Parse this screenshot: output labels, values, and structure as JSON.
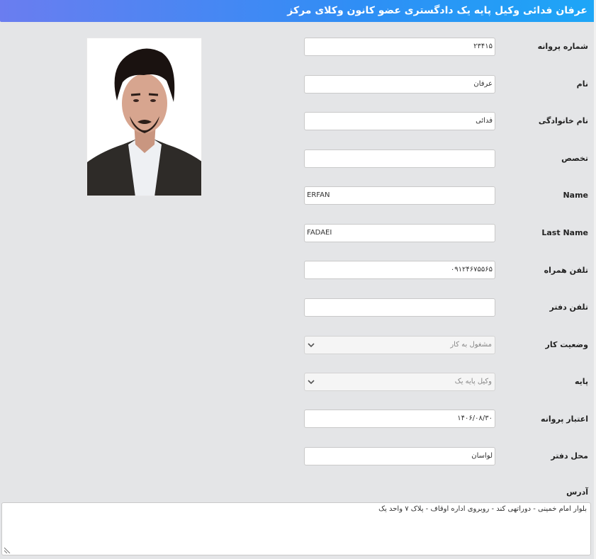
{
  "header": {
    "title": "عرفان فدائی وکیل پایه یک دادگستری عضو کانون وکلای مرکز"
  },
  "form": {
    "license_number": {
      "label": "شماره پروانه",
      "value": "۲۳۴۱۵"
    },
    "first_name": {
      "label": "نام",
      "value": "عرفان"
    },
    "family_name": {
      "label": "نام خانوادگی",
      "value": "فدائی"
    },
    "specialty": {
      "label": "تخصص",
      "value": ""
    },
    "name_en": {
      "label": "Name",
      "value": "ERFAN"
    },
    "last_name_en": {
      "label": "Last Name",
      "value": "FADAEI"
    },
    "mobile": {
      "label": "تلفن همراه",
      "value": "۰۹۱۲۴۶۷۵۵۶۵"
    },
    "office_phone": {
      "label": "تلفن دفتر",
      "value": ""
    },
    "work_status": {
      "label": "وضعیت کار",
      "value": "مشغول به کار"
    },
    "grade": {
      "label": "پایه",
      "value": "وکیل پایه یک"
    },
    "license_validity": {
      "label": "اعتبار پروانه",
      "value": "۱۴۰۶/۰۸/۳۰"
    },
    "office_location": {
      "label": "محل دفتر",
      "value": "لواسان"
    },
    "address": {
      "label": "آدرس",
      "value": "بلوار امام خمینی - دوراتهی کند - روبروی اداره اوقاف - پلاک ۷ واحد یک"
    }
  },
  "colors": {
    "header_start": "#6a7df0",
    "header_end": "#1da6f7",
    "background": "#e4e5e7"
  }
}
